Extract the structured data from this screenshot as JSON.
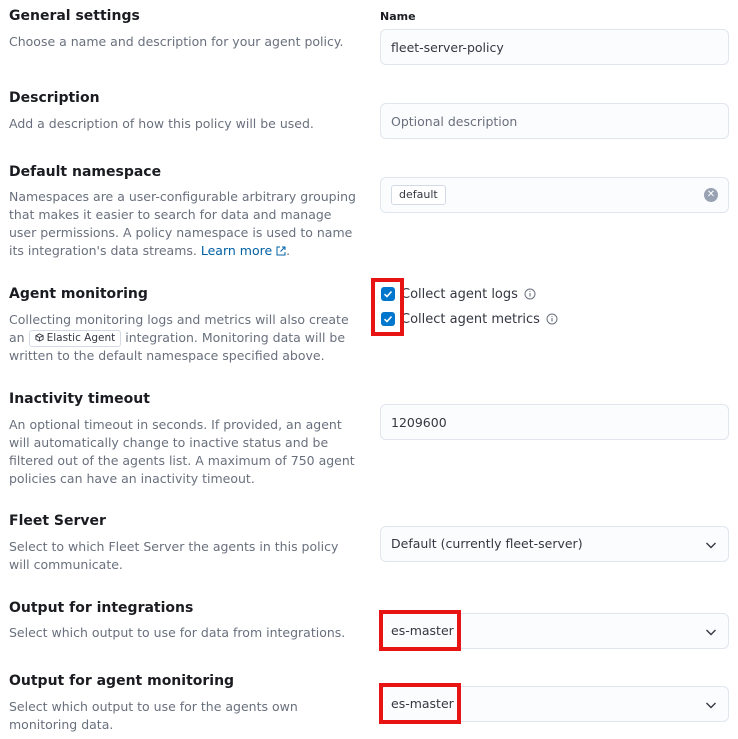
{
  "general": {
    "title": "General settings",
    "desc": "Choose a name and description for your agent policy.",
    "name_label": "Name",
    "name_value": "fleet-server-policy"
  },
  "description": {
    "title": "Description",
    "desc": "Add a description of how this policy will be used.",
    "placeholder": "Optional description"
  },
  "namespace": {
    "title": "Default namespace",
    "desc": "Namespaces are a user-configurable arbitrary grouping that makes it easier to search for data and manage user permissions. A policy namespace is used to name its integration's data streams.",
    "learn_more": "Learn more",
    "value": "default"
  },
  "monitoring": {
    "title": "Agent monitoring",
    "desc_before": "Collecting monitoring logs and metrics will also create an",
    "badge": "Elastic Agent",
    "desc_after": "integration. Monitoring data will be written to the default namespace specified above.",
    "collect_logs": "Collect agent logs",
    "collect_metrics": "Collect agent metrics",
    "collect_logs_checked": true,
    "collect_metrics_checked": true
  },
  "inactivity": {
    "title": "Inactivity timeout",
    "desc": "An optional timeout in seconds. If provided, an agent will automatically change to inactive status and be filtered out of the agents list. A maximum of 750 agent policies can have an inactivity timeout.",
    "value": "1209600"
  },
  "fleet_server": {
    "title": "Fleet Server",
    "desc": "Select to which Fleet Server the agents in this policy will communicate.",
    "value": "Default (currently fleet-server)"
  },
  "output_integrations": {
    "title": "Output for integrations",
    "desc": "Select which output to use for data from integrations.",
    "value": "es-master"
  },
  "output_monitoring": {
    "title": "Output for agent monitoring",
    "desc": "Select which output to use for the agents own monitoring data.",
    "value": "es-master"
  },
  "colors": {
    "checkbox": "#0077cc",
    "link": "#0061a6",
    "highlight": "#e81313"
  }
}
